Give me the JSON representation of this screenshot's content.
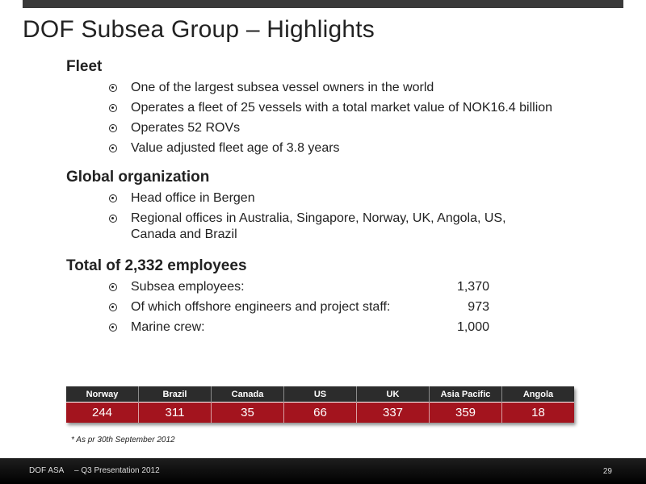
{
  "title": "DOF Subsea Group – Highlights",
  "sections": {
    "fleet": {
      "heading": "Fleet",
      "items": [
        "One of the largest subsea vessel owners in the world",
        "Operates a fleet of 25 vessels with a total market value of NOK16.4 billion",
        "Operates 52 ROVs",
        "Value adjusted fleet age of 3.8 years"
      ]
    },
    "global": {
      "heading": "Global organization",
      "items": [
        "Head office in Bergen",
        "Regional offices in Australia, Singapore, Norway, UK, Angola, US,\nCanada and Brazil"
      ]
    },
    "total": {
      "heading": "Total of 2,332 employees",
      "items": [
        {
          "label": "Subsea employees:",
          "value": "1,370"
        },
        {
          "label": "Of which offshore engineers and project staff:",
          "value": "973"
        },
        {
          "label": "Marine crew:",
          "value": "1,000"
        }
      ]
    }
  },
  "employees_by_region": {
    "headers": [
      "Norway",
      "Brazil",
      "Canada",
      "US",
      "UK",
      "Asia Pacific",
      "Angola"
    ],
    "values": [
      "244",
      "311",
      "35",
      "66",
      "337",
      "359",
      "18"
    ]
  },
  "footnote": "* As pr 30th September 2012",
  "footer": {
    "company": "DOF ASA",
    "presentation": "– Q3 Presentation 2012",
    "page": "29"
  },
  "colors": {
    "table_header": "#2c2c2c",
    "table_value": "#a3141e",
    "footer": "#000000"
  }
}
